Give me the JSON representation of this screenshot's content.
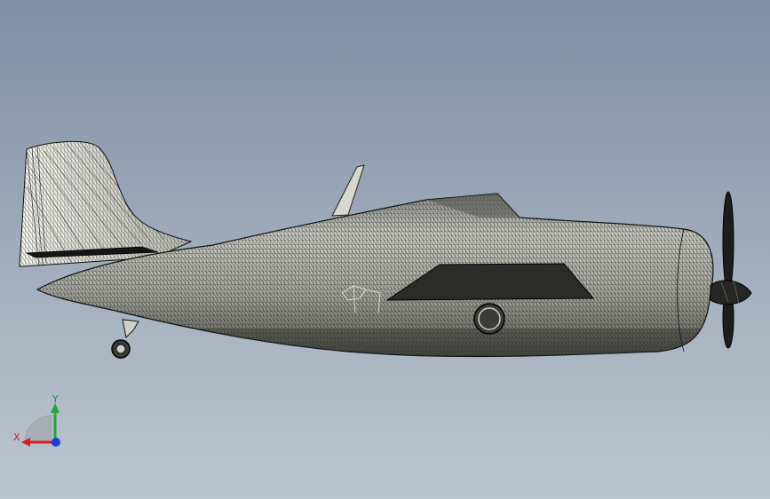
{
  "viewport": {
    "model": "aircraft-wireframe-mesh",
    "background_top": "#7f8ea4",
    "background_bottom": "#bcc5cf"
  },
  "triad": {
    "x_label": "X",
    "y_label": "Y",
    "x_color": "#d21f1f",
    "y_color": "#23a43b",
    "z_color": "#1e3fd0"
  }
}
